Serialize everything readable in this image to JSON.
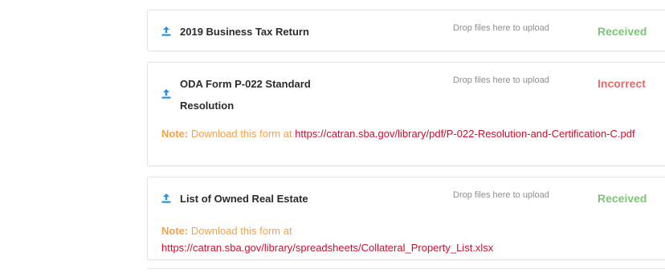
{
  "documents": [
    {
      "title": "2019 Business Tax Return",
      "drop_text": "Drop files here to upload",
      "status": "Received",
      "icon": "upload-icon"
    },
    {
      "title_line1": "ODA Form P-022 Standard",
      "title_line2": "Resolution",
      "drop_text": "Drop files here to upload",
      "status": "Incorrect",
      "note_label": "Note:",
      "note_text": "Download this form at",
      "note_link": "https://catran.sba.gov/library/pdf/P-022-Resolution-and-Certification-C.pdf",
      "icon": "upload-icon"
    },
    {
      "title": "List of Owned Real Estate",
      "drop_text": "Drop files here to upload",
      "status": "Received",
      "note_label": "Note:",
      "note_text": "Download this form at",
      "note_link": "https://catran.sba.gov/library/spreadsheets/Collateral_Property_List.xlsx",
      "icon": "upload-icon"
    }
  ],
  "colors": {
    "received": "#7cc576",
    "incorrect": "#e36b6b",
    "note": "#f0a24a",
    "link": "#c8102e",
    "icon": "#2f8fd8"
  }
}
